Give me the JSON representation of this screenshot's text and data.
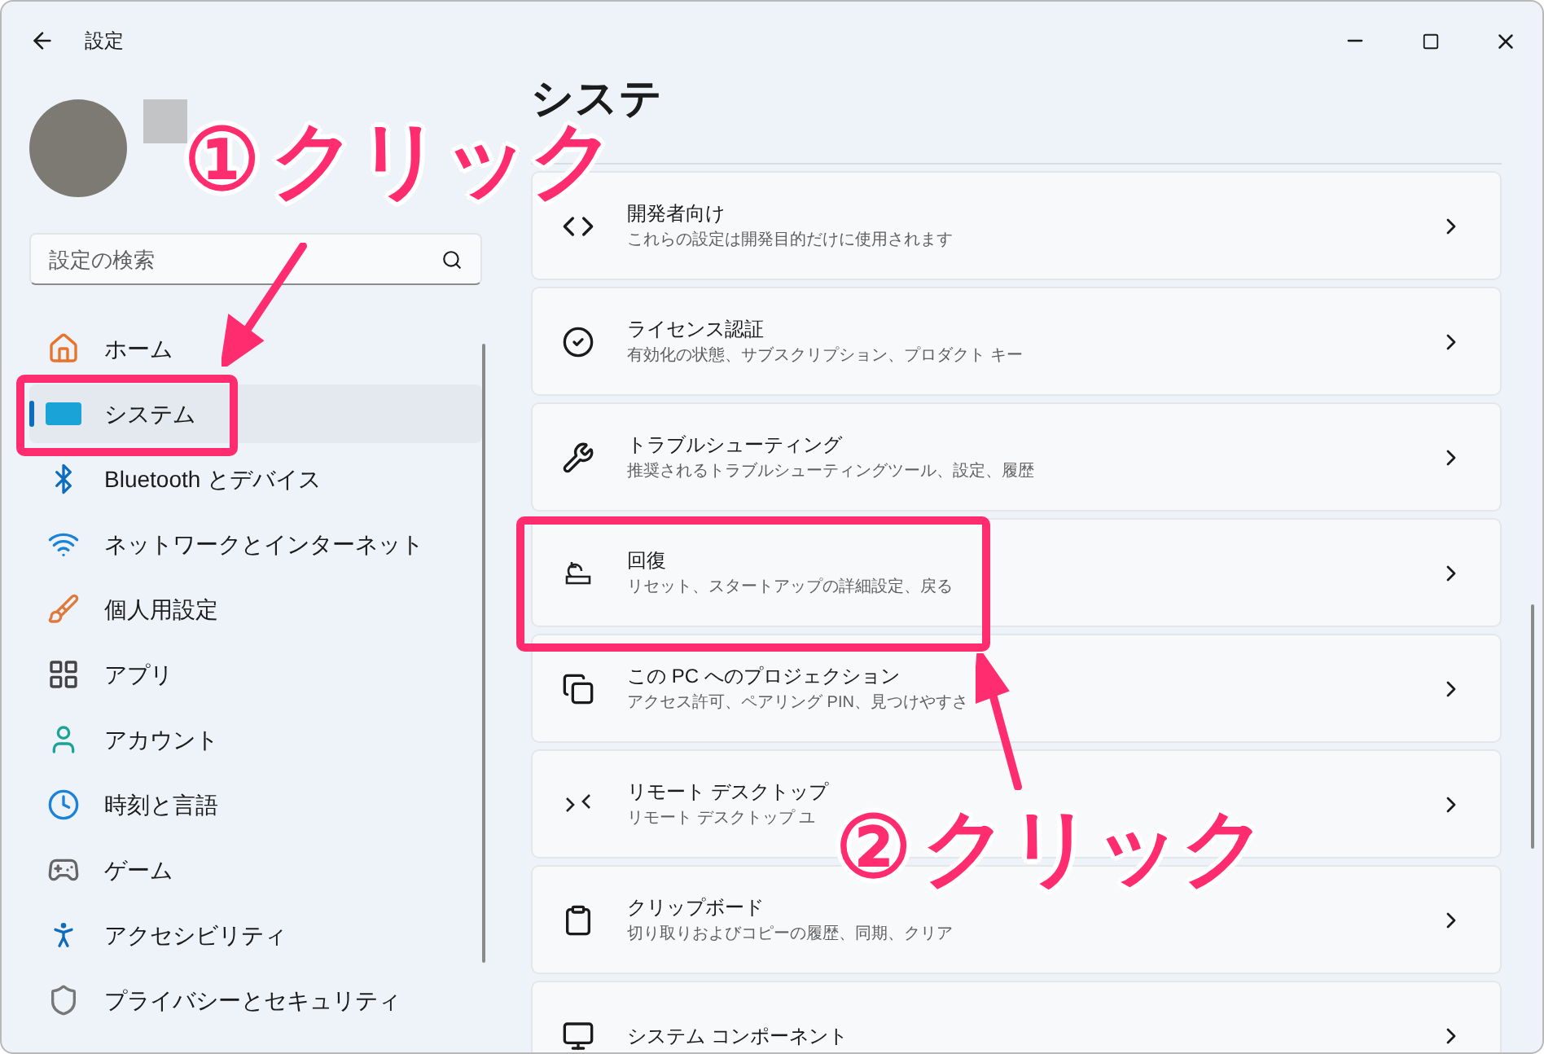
{
  "window": {
    "title": "設定"
  },
  "search": {
    "placeholder": "設定の検索"
  },
  "sidebar": {
    "items": [
      {
        "label": "ホーム",
        "selected": false
      },
      {
        "label": "システム",
        "selected": true
      },
      {
        "label": "Bluetooth とデバイス",
        "selected": false
      },
      {
        "label": "ネットワークとインターネット",
        "selected": false
      },
      {
        "label": "個人用設定",
        "selected": false
      },
      {
        "label": "アプリ",
        "selected": false
      },
      {
        "label": "アカウント",
        "selected": false
      },
      {
        "label": "時刻と言語",
        "selected": false
      },
      {
        "label": "ゲーム",
        "selected": false
      },
      {
        "label": "アクセシビリティ",
        "selected": false
      },
      {
        "label": "プライバシーとセキュリティ",
        "selected": false
      }
    ]
  },
  "page": {
    "title": "システ"
  },
  "settings": [
    {
      "title": "開発者向け",
      "description": "これらの設定は開発目的だけに使用されます"
    },
    {
      "title": "ライセンス認証",
      "description": "有効化の状態、サブスクリプション、プロダクト キー"
    },
    {
      "title": "トラブルシューティング",
      "description": "推奨されるトラブルシューティングツール、設定、履歴"
    },
    {
      "title": "回復",
      "description": "リセット、スタートアップの詳細設定、戻る"
    },
    {
      "title": "この PC へのプロジェクション",
      "description": "アクセス許可、ペアリング PIN、見つけやすさ"
    },
    {
      "title": "リモート デスクトップ",
      "description": "リモート デスクトップ ユ"
    },
    {
      "title": "クリップボード",
      "description": "切り取りおよびコピーの履歴、同期、クリア"
    },
    {
      "title": "システム コンポーネント"
    }
  ],
  "annotations": [
    {
      "number": "①",
      "label": "クリック"
    },
    {
      "number": "②",
      "label": "クリック"
    }
  ]
}
